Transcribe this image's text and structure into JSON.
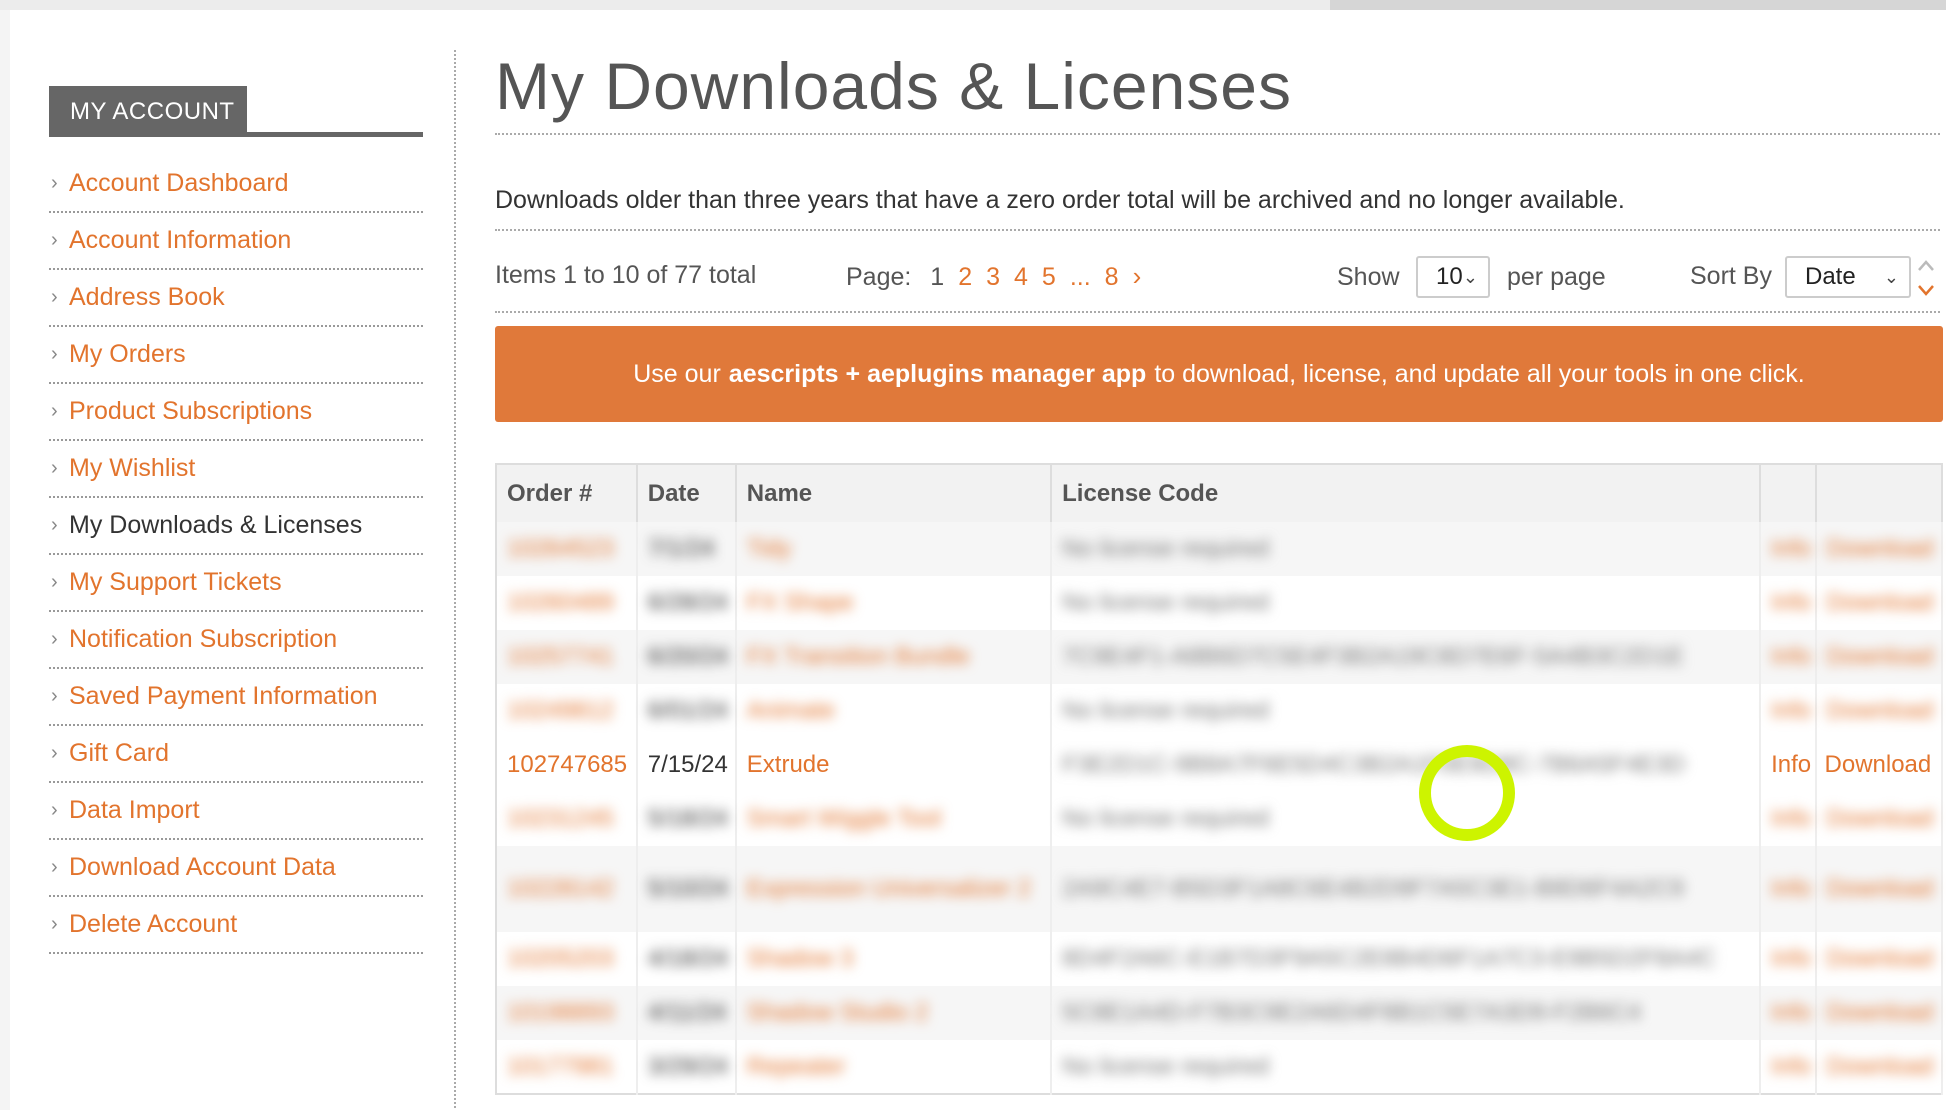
{
  "sidebar": {
    "header": "MY ACCOUNT",
    "chevron": "›",
    "items": [
      {
        "label": "Account Dashboard",
        "active": false
      },
      {
        "label": "Account Information",
        "active": false
      },
      {
        "label": "Address Book",
        "active": false
      },
      {
        "label": "My Orders",
        "active": false
      },
      {
        "label": "Product Subscriptions",
        "active": false
      },
      {
        "label": "My Wishlist",
        "active": false
      },
      {
        "label": "My Downloads & Licenses",
        "active": true
      },
      {
        "label": "My Support Tickets",
        "active": false
      },
      {
        "label": "Notification Subscription",
        "active": false
      },
      {
        "label": "Saved Payment Information",
        "active": false
      },
      {
        "label": "Gift Card",
        "active": false
      },
      {
        "label": "Data Import",
        "active": false
      },
      {
        "label": "Download Account Data",
        "active": false
      },
      {
        "label": "Delete Account",
        "active": false
      }
    ]
  },
  "main": {
    "title": "My Downloads & Licenses",
    "notice": "Downloads older than three years that have a zero order total will be archived and no longer available.",
    "toolbar": {
      "items_count": "Items 1 to 10 of 77 total",
      "page_label": "Page:",
      "pages": [
        "1",
        "2",
        "3",
        "4",
        "5",
        "...",
        "8"
      ],
      "current_page": "1",
      "next_arrow": "›",
      "show_label": "Show",
      "per_page_value": "10",
      "per_page_label": "per page",
      "sort_label": "Sort By",
      "sort_value": "Date"
    },
    "banner": {
      "prefix": "Use our",
      "bold": "aescripts + aeplugins manager app",
      "suffix": "to download, license, and update all your tools in one click."
    },
    "table": {
      "headers": [
        "Order #",
        "Date",
        "Name",
        "License Code",
        "",
        ""
      ],
      "rows": [
        {
          "order": "10264523",
          "date": "7/1/24",
          "name": "Tidy",
          "license": "No license required",
          "info": "Info",
          "download": "Download",
          "blurred": true
        },
        {
          "order": "10260489",
          "date": "6/28/24",
          "name": "FX Shape",
          "license": "No license required",
          "info": "Info",
          "download": "Download",
          "blurred": true
        },
        {
          "order": "10257741",
          "date": "6/20/24",
          "name": "FX Transition Bundle",
          "license": "7C9E4F1-A8B6D7C5E4F3B2A19C8D7E6F-5A4B3C2D1E",
          "info": "Info",
          "download": "Download",
          "blurred": true
        },
        {
          "order": "10249812",
          "date": "6/01/24",
          "name": "Animate",
          "license": "No license required",
          "info": "Info",
          "download": "Download",
          "blurred": true
        },
        {
          "order": "102747685",
          "date": "7/15/24",
          "name": "Extrude",
          "license": "F3E2D1C-9B8A7F6E5D4C3B2A1F0E9D8C-7B6A5F4E3D",
          "info": "Info",
          "download": "Download",
          "blurred": false
        },
        {
          "order": "10231245",
          "date": "5/18/24",
          "name": "Smart Wiggle Tool",
          "license": "No license required",
          "info": "Info",
          "download": "Download",
          "blurred": true
        },
        {
          "order": "10228142",
          "date": "5/10/24",
          "name": "Expression Universalizer 2",
          "license": "2A9C4E7-B5D3F1A8C6E4B2D9F7A5C3E1-B8D6F4A2C9",
          "info": "Info",
          "download": "Download",
          "blurred": true
        },
        {
          "order": "10205203",
          "date": "4/18/24",
          "name": "Shadow 3",
          "license": "8D4F2A6C-E1B7D3F9A5C2E8B4D6F1A7C3-E9B5D2F8A4C",
          "info": "Info",
          "download": "Download",
          "blurred": true
        },
        {
          "order": "10198893",
          "date": "4/11/24",
          "name": "Shadow Studio 2",
          "license": "5C8E1A4D-F7B3C9E2A6D4F8B1C5E7A3D9-F2B6C4",
          "info": "Info",
          "download": "Download",
          "blurred": true
        },
        {
          "order": "10177981",
          "date": "3/29/24",
          "name": "Repeater",
          "license": "No license required",
          "info": "Info",
          "download": "Download",
          "blurred": true
        }
      ]
    }
  },
  "colors": {
    "accent": "#e2742d",
    "banner": "#e0793a",
    "highlight": "#cdf400",
    "sidebar_header": "#666666"
  }
}
